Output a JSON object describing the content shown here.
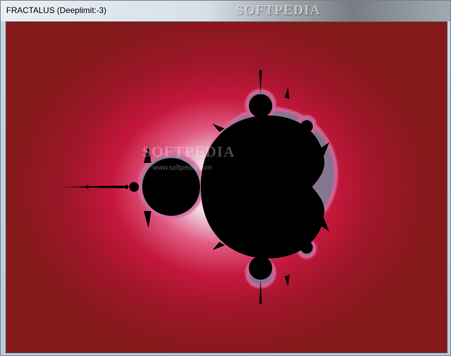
{
  "window": {
    "title": "FRACTALUS (Deeplimit:-3)"
  },
  "watermarks": {
    "top": "SOFTPEDIA",
    "center": "SOFTPEDIA",
    "url": "www.softpedia.com"
  },
  "colors": {
    "background_outer": "#84191a",
    "background_mid": "#c5173c",
    "glow_inner": "#f5f0f6",
    "fractal_fill": "#000000",
    "fractal_edge": "#d86aa0"
  }
}
